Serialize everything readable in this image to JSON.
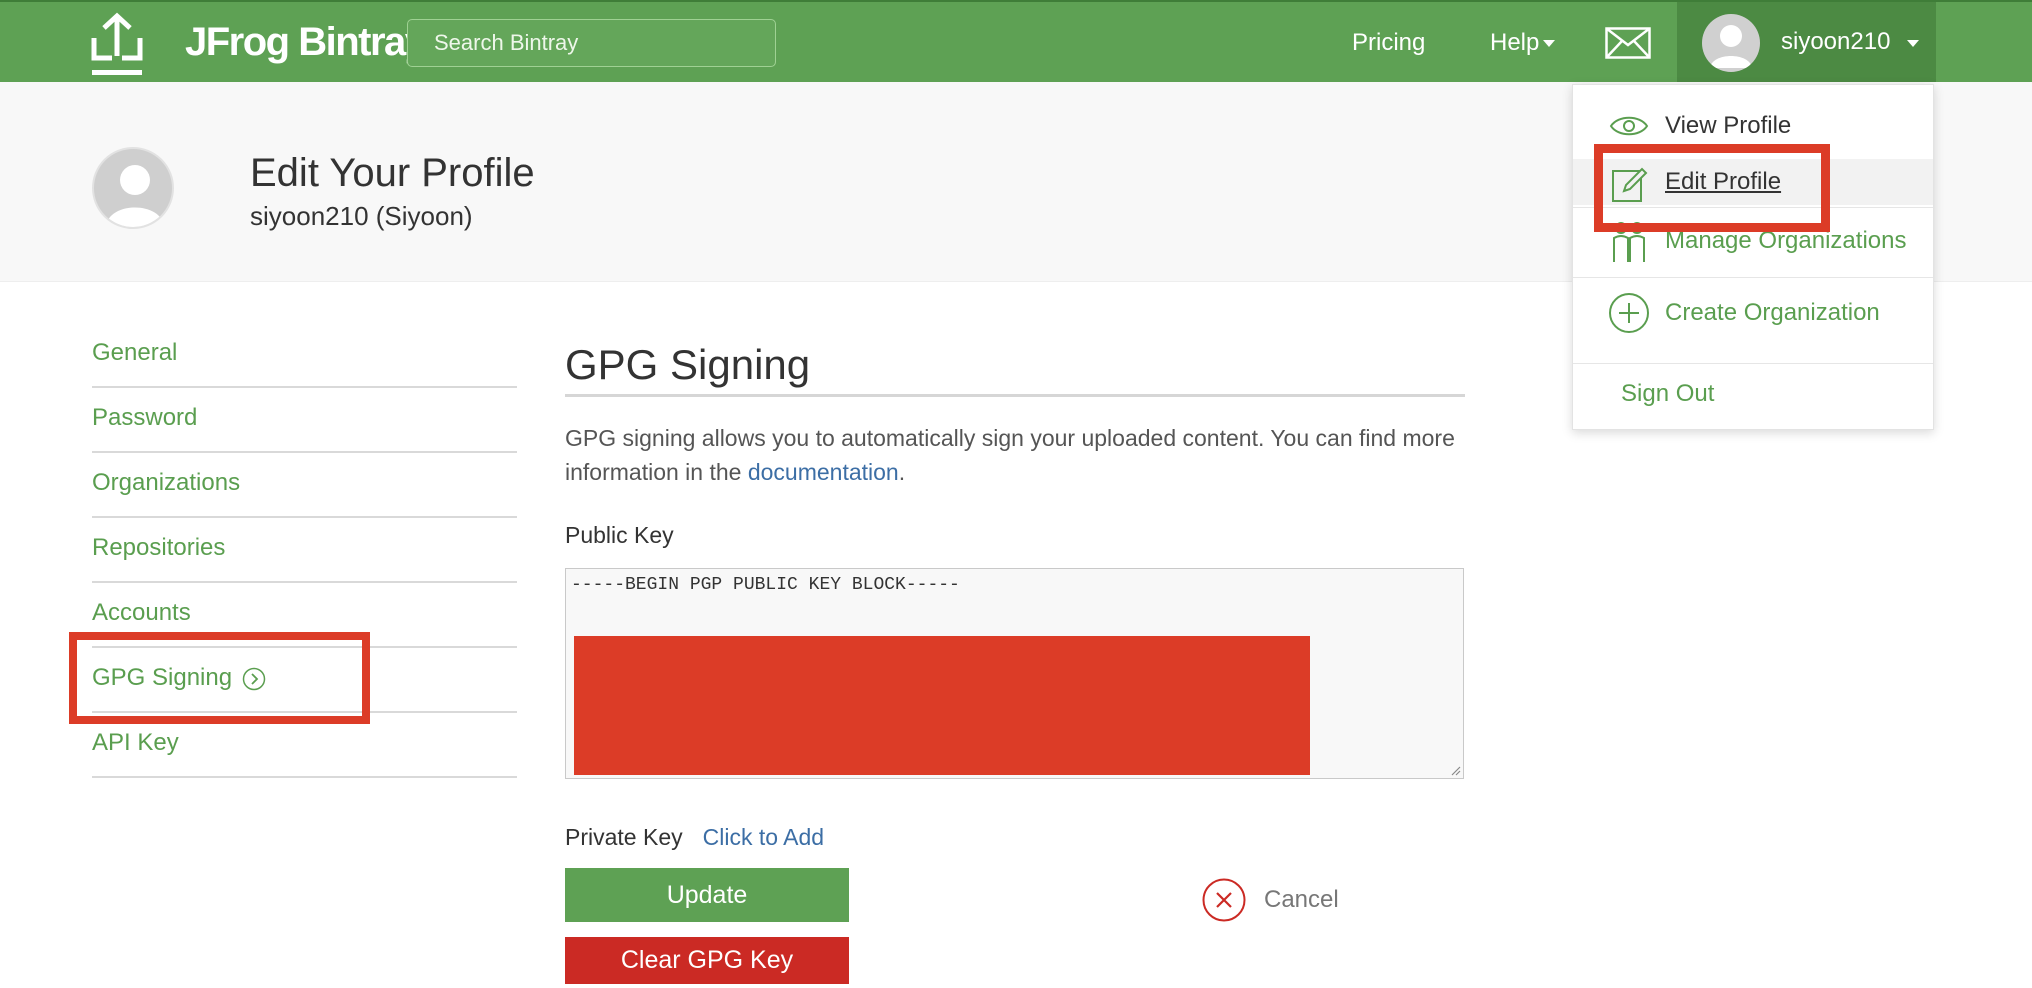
{
  "header": {
    "brand": "JFrog Bintray",
    "search_placeholder": "Search Bintray",
    "nav": {
      "pricing": "Pricing",
      "help": "Help"
    },
    "username": "siyoon210"
  },
  "user_menu": {
    "items": [
      {
        "label": "View Profile"
      },
      {
        "label": "Edit Profile"
      },
      {
        "label": "Manage Organizations"
      },
      {
        "label": "Create Organization"
      },
      {
        "label": "Sign Out"
      }
    ]
  },
  "profile": {
    "title": "Edit Your Profile",
    "subtitle": "siyoon210 (Siyoon)"
  },
  "sidebar": {
    "items": [
      {
        "label": "General"
      },
      {
        "label": "Password"
      },
      {
        "label": "Organizations"
      },
      {
        "label": "Repositories"
      },
      {
        "label": "Accounts"
      },
      {
        "label": "GPG Signing"
      },
      {
        "label": "API Key"
      }
    ]
  },
  "gpg": {
    "title": "GPG Signing",
    "description_prefix": "GPG signing allows you to automatically sign your uploaded content. You can find more information in the ",
    "description_link": "documentation",
    "description_suffix": ".",
    "public_key_label": "Public Key",
    "public_key_first_line": "-----BEGIN PGP PUBLIC KEY BLOCK-----",
    "private_key_label": "Private Key",
    "private_key_action": "Click to Add",
    "update_label": "Update",
    "clear_label": "Clear GPG Key",
    "cancel_label": "Cancel"
  },
  "colors": {
    "brand_green": "#5ea154",
    "link_green": "#5a9e4f",
    "link_blue": "#3c6ea5",
    "danger_red": "#cb2a24",
    "highlight_red": "#dc3c27"
  },
  "icons": [
    "bintray-logo-icon",
    "mail-icon",
    "avatar-icon",
    "eye-icon",
    "pencil-icon",
    "people-icon",
    "plus-circle-icon",
    "arrow-circle-icon",
    "close-circle-icon"
  ]
}
